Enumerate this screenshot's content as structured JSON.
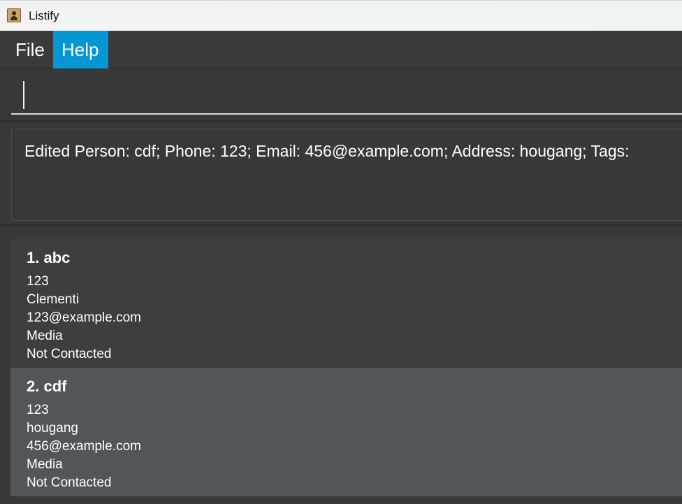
{
  "window": {
    "title": "Listify",
    "icon": "address-book-icon"
  },
  "menu": {
    "items": [
      {
        "label": "File"
      },
      {
        "label": "Help"
      }
    ],
    "active_index": 1
  },
  "command_box": {
    "value": ""
  },
  "result_display": {
    "text": "Edited Person: cdf; Phone: 123; Email: 456@example.com; Address: hougang; Tags:"
  },
  "persons": [
    {
      "name": "1. abc",
      "phone": "123",
      "address": "Clementi",
      "email": "123@example.com",
      "tag": "Media",
      "status": "Not Contacted"
    },
    {
      "name": "2. cdf",
      "phone": "123",
      "address": "hougang",
      "email": "456@example.com",
      "tag": "Media",
      "status": "Not Contacted"
    }
  ],
  "colors": {
    "accent": "#0497d3",
    "background": "#383838",
    "card": "#3c3e3f",
    "card_selected": "#515658"
  }
}
